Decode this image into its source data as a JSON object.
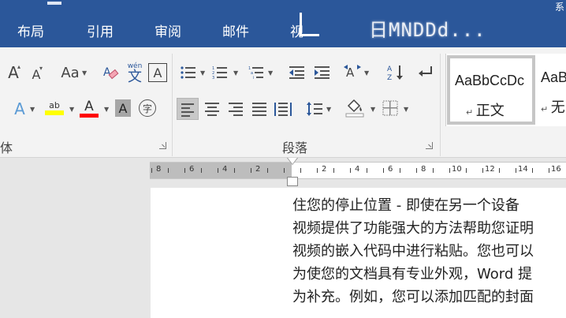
{
  "window": {
    "title": "系"
  },
  "tabs": [
    {
      "label": "布局"
    },
    {
      "label": "引用"
    },
    {
      "label": "审阅"
    },
    {
      "label": "邮件"
    },
    {
      "label": "视"
    }
  ],
  "overlay": {
    "text": "日MNDDd..."
  },
  "ribbon": {
    "font_group": {
      "label": "体",
      "grow_label": "A",
      "shrink_label": "A",
      "change_case_label": "Aa",
      "pinyin_label": "wén",
      "pinyin_char": "文",
      "border_char": "A",
      "text_effect_label": "A",
      "highlight_label": "ab",
      "font_color_label": "A",
      "char_shading_label": "A",
      "enclose_char": "字",
      "highlight_color": "#ffff00",
      "font_color": "#ff0000"
    },
    "paragraph_group": {
      "label": "段落"
    },
    "styles": [
      {
        "sample": "AaBbCcDc",
        "name": "正文"
      },
      {
        "sample": "AaB",
        "name": "无"
      }
    ]
  },
  "ruler": {
    "numbers": [
      "8",
      "6",
      "4",
      "2",
      "2",
      "4",
      "6",
      "8",
      "10",
      "12",
      "14",
      "16"
    ]
  },
  "document": {
    "lines": [
      "住您的停止位置 - 即使在另一个设备",
      "视频提供了功能强大的方法帮助您证明",
      "视频的嵌入代码中进行粘贴。您也可以",
      "为使您的文档具有专业外观，Word 提",
      "为补充。例如，您可以添加匹配的封面"
    ]
  },
  "colors": {
    "accent": "#2b579a",
    "ribbon_bg": "#f3f3f3",
    "page_bg": "#ffffff"
  }
}
